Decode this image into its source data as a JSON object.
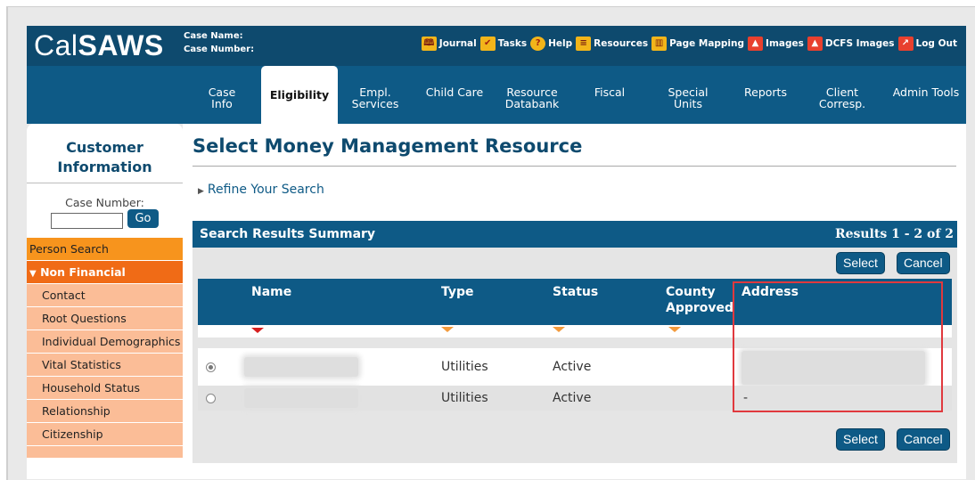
{
  "app": {
    "logo_light": "Cal",
    "logo_bold": "SAWS"
  },
  "case": {
    "name_label": "Case Name:",
    "number_label": "Case Number:"
  },
  "top_links": [
    {
      "label": "Journal",
      "icon": "book-icon",
      "color": "#f2b51a"
    },
    {
      "label": "Tasks",
      "icon": "checkbox-icon",
      "color": "#f2b51a"
    },
    {
      "label": "Help",
      "icon": "help-icon",
      "color": "#f2b51a"
    },
    {
      "label": "Resources",
      "icon": "document-icon",
      "color": "#f2b51a"
    },
    {
      "label": "Page Mapping",
      "icon": "map-icon",
      "color": "#f2b51a"
    },
    {
      "label": "Images",
      "icon": "image-icon",
      "color": "#e8402e"
    },
    {
      "label": "DCFS Images",
      "icon": "image-icon",
      "color": "#e8402e"
    },
    {
      "label": "Log Out",
      "icon": "logout-icon",
      "color": "#e8402e"
    }
  ],
  "nav": {
    "tabs": [
      {
        "line1": "Case Info",
        "line2": ""
      },
      {
        "line1": "Eligibility",
        "line2": "",
        "active": true
      },
      {
        "line1": "Empl.",
        "line2": "Services"
      },
      {
        "line1": "Child Care",
        "line2": ""
      },
      {
        "line1": "Resource",
        "line2": "Databank"
      },
      {
        "line1": "Fiscal",
        "line2": ""
      },
      {
        "line1": "Special",
        "line2": "Units"
      },
      {
        "line1": "Reports",
        "line2": ""
      },
      {
        "line1": "Client",
        "line2": "Corresp."
      },
      {
        "line1": "Admin Tools",
        "line2": ""
      }
    ]
  },
  "sidebar": {
    "title_line1": "Customer",
    "title_line2": "Information",
    "case_number_label": "Case Number:",
    "case_number_value": "",
    "go_label": "Go",
    "person_search": "Person Search",
    "section": "Non Financial",
    "items": [
      "Contact",
      "Root Questions",
      "Individual Demographics",
      "Vital Statistics",
      "Household Status",
      "Relationship",
      "Citizenship"
    ]
  },
  "main": {
    "title": "Select Money Management Resource",
    "refine_label": "Refine Your Search",
    "results_title": "Search Results Summary",
    "results_count": "Results 1 - 2 of 2",
    "select_label": "Select",
    "cancel_label": "Cancel",
    "columns": {
      "name": "Name",
      "type": "Type",
      "status": "Status",
      "county_line1": "County",
      "county_line2": "Approved",
      "address": "Address"
    },
    "rows": [
      {
        "selected": true,
        "type": "Utilities",
        "status": "Active",
        "address": ""
      },
      {
        "selected": false,
        "type": "Utilities",
        "status": "Active",
        "address": "-"
      }
    ]
  }
}
